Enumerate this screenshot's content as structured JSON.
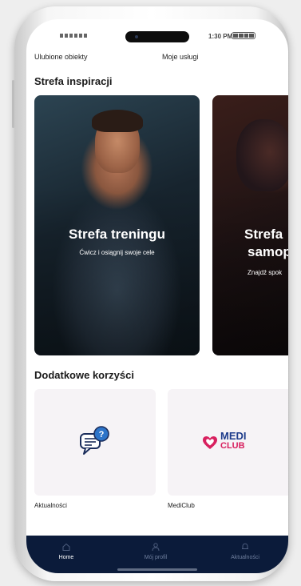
{
  "status_bar": {
    "time": "1:30 PM"
  },
  "quick_links": [
    "Ulubione obiekty",
    "Moje usługi"
  ],
  "inspiration": {
    "title": "Strefa inspiracji",
    "cards": [
      {
        "title": "Strefa treningu",
        "subtitle": "Ćwicz i osiągnij swoje cele"
      },
      {
        "title_line1": "Strefa",
        "title_line2": "samop",
        "subtitle": "Znajdź spok"
      }
    ]
  },
  "benefits": {
    "title": "Dodatkowe korzyści",
    "tiles": [
      {
        "label": "Aktualności",
        "icon": "chat-question-icon"
      },
      {
        "label": "MediClub",
        "logo_line1": "MEDI",
        "logo_line2": "CLUB"
      }
    ]
  },
  "nav": {
    "items": [
      {
        "label": "Home",
        "icon": "home-icon"
      },
      {
        "label": "Mój profil",
        "icon": "profile-icon"
      },
      {
        "label": "Aktualności",
        "icon": "bell-icon"
      }
    ]
  },
  "colors": {
    "nav_bg": "#0b1b3a",
    "nav_active": "#ffffff",
    "nav_inactive": "#6f7f9e",
    "mediclub_pink": "#d8205f",
    "mediclub_blue": "#1f3d8c",
    "chat_icon_blue": "#2d74c9",
    "chat_icon_navy": "#1c2e5c"
  }
}
